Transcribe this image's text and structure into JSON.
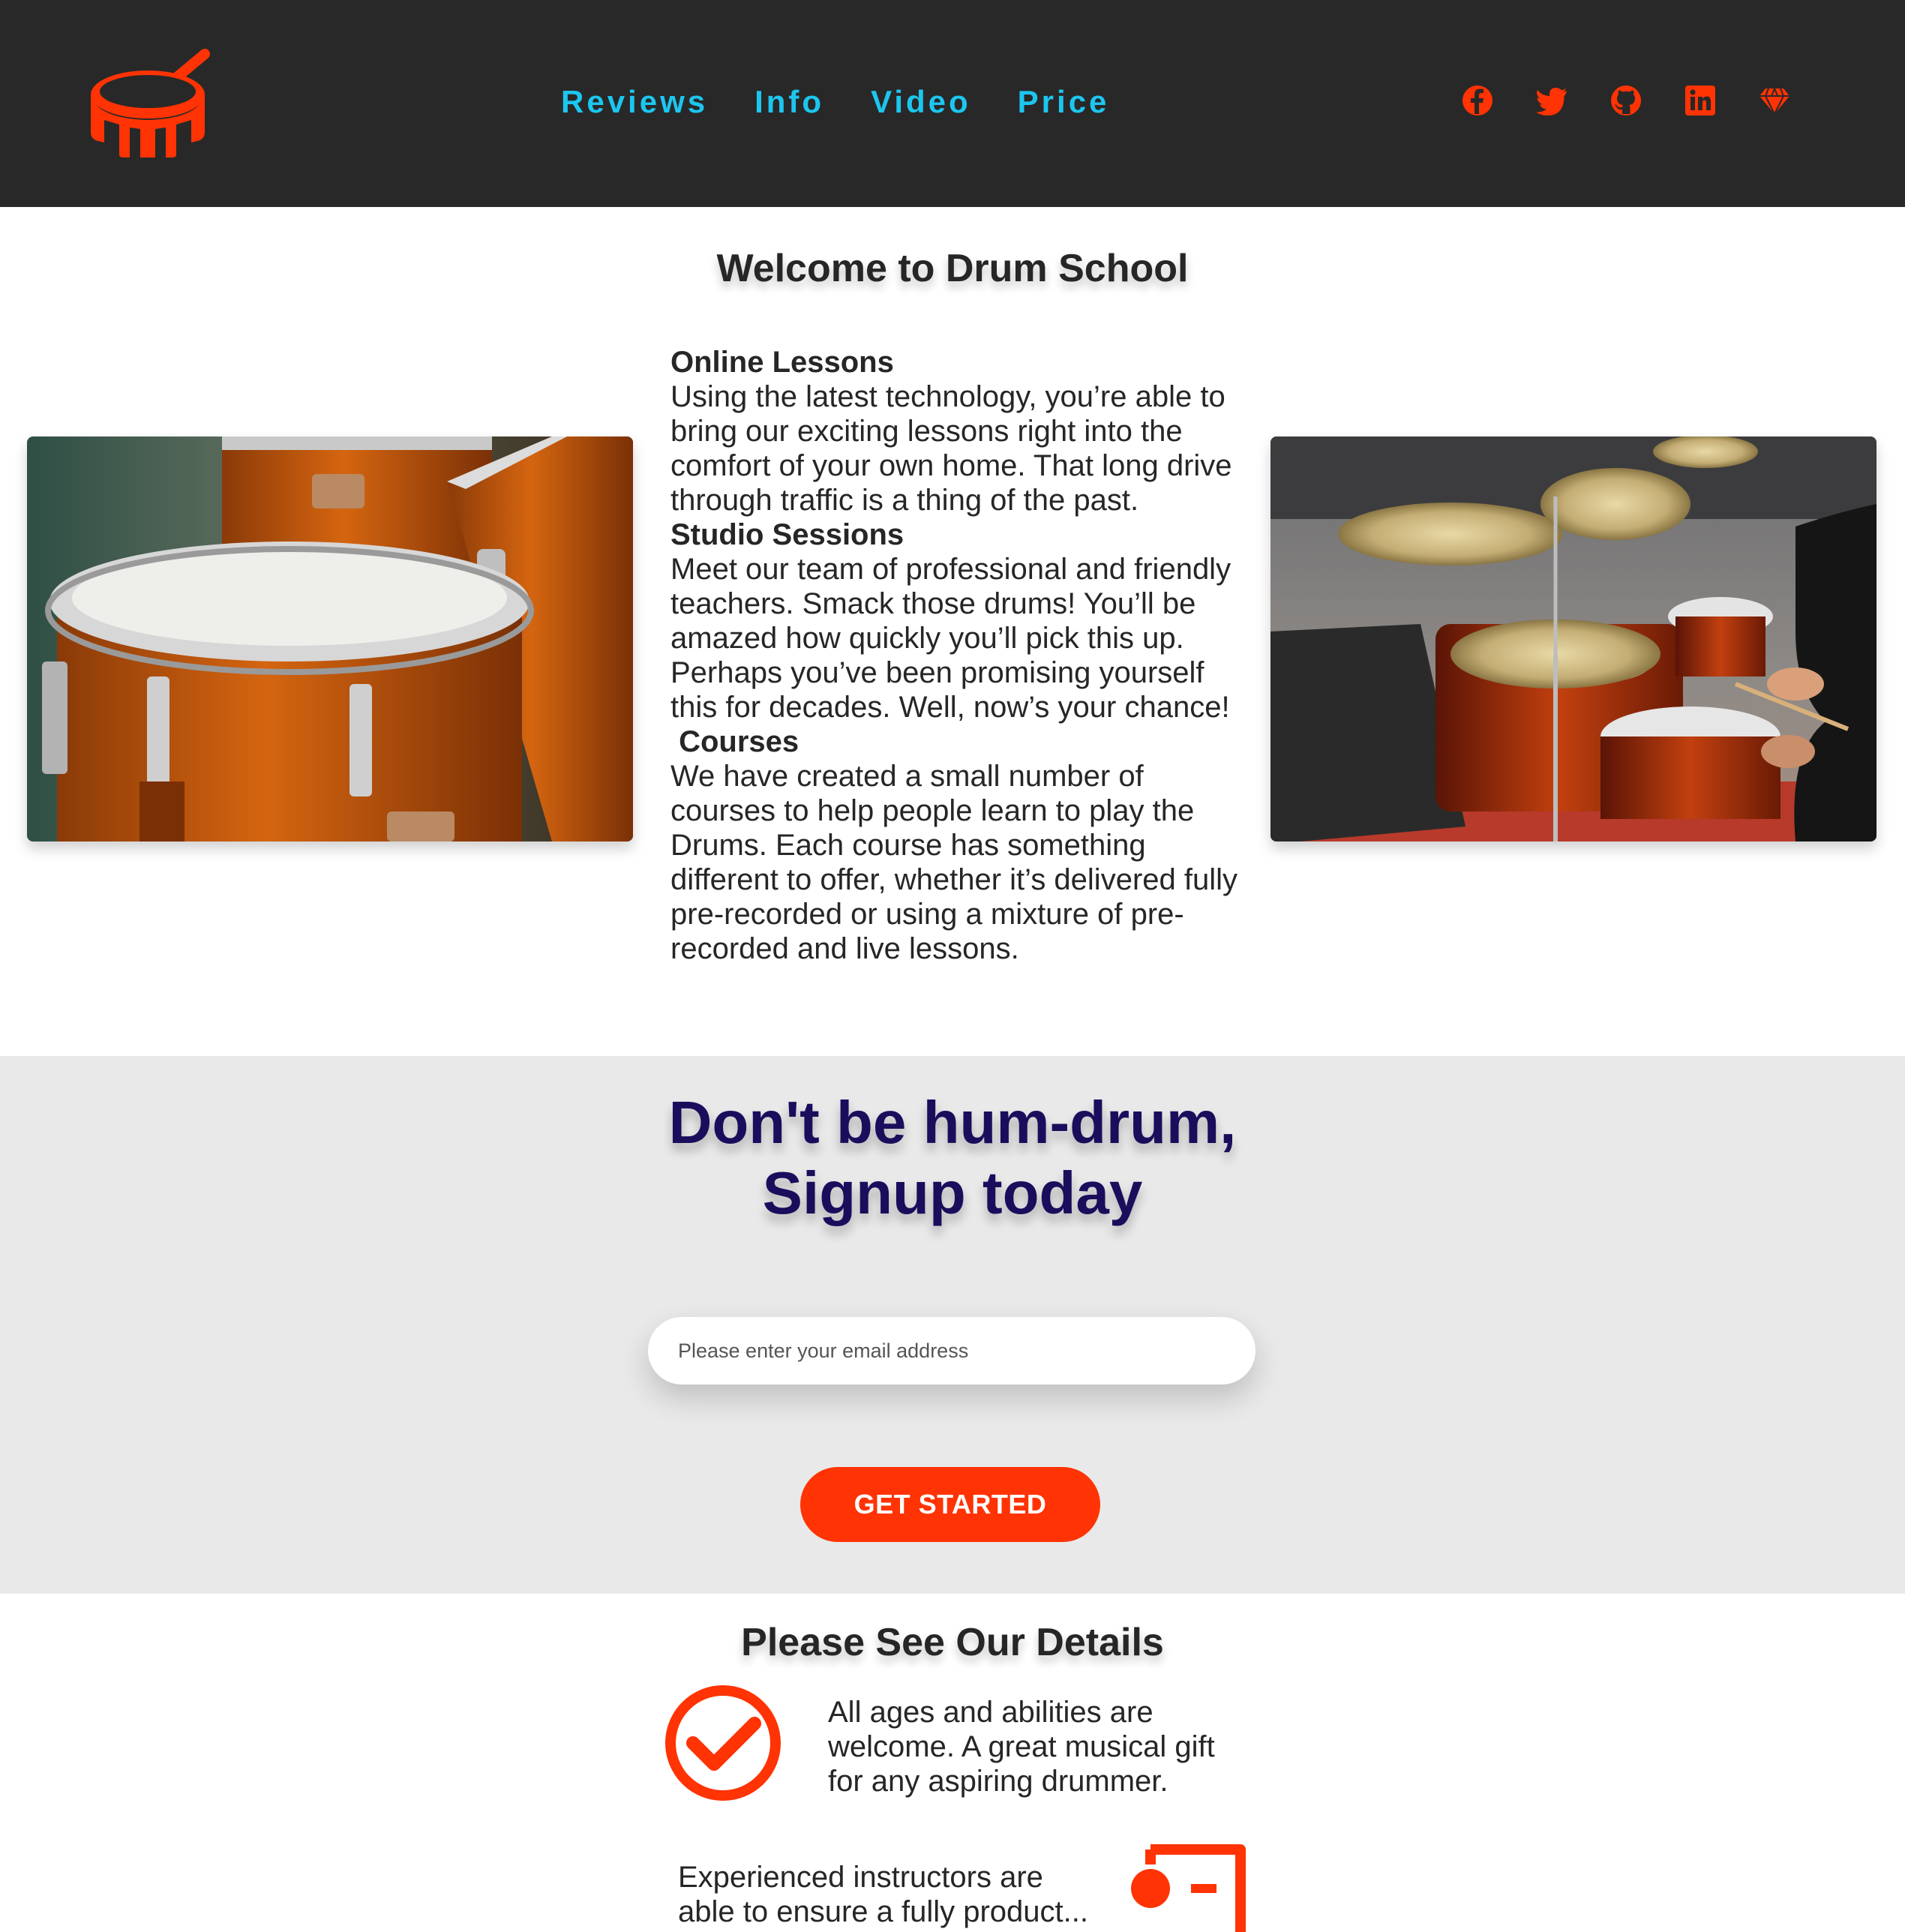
{
  "nav": {
    "items": [
      "Reviews",
      "Info",
      "Video",
      "Price"
    ]
  },
  "socials": [
    "facebook-icon",
    "twitter-icon",
    "github-icon",
    "linkedin-icon",
    "gem-icon"
  ],
  "colors": {
    "header_bg": "#282828",
    "nav_link": "#1cc6ef",
    "accent": "#ff3303",
    "signup_title": "#1b0d5c",
    "signup_bg": "#e9e9e9"
  },
  "welcome": {
    "title": "Welcome to Drum School",
    "sections": [
      {
        "heading": "Online Lessons",
        "body": "Using the latest technology, you’re able to bring our exciting lessons right into the comfort of your own home. That long drive through traffic is a thing of the past."
      },
      {
        "heading": "Studio Sessions",
        "body": "Meet our team of professional and friendly teachers. Smack those drums! You’ll be amazed how quickly you’ll pick this up. Perhaps you’ve been promising yourself this for decades. Well, now’s your chance!"
      },
      {
        "heading": " Courses",
        "body": "We have created a small number of courses to help people learn to play the Drums. Each course has something different to offer, whether it’s delivered fully pre-recorded or using a mixture of pre-recorded and live lessons."
      }
    ]
  },
  "signup": {
    "title_line1": "Don't be hum-drum,",
    "title_line2": "Signup today",
    "email_placeholder": "Please enter your email address",
    "button_label": "GET STARTED"
  },
  "details": {
    "title": "Please See Our Details",
    "items": [
      {
        "icon": "checkmark-circle-icon",
        "text": "All ages and abilities are welcome. A great musical gift for any aspiring drummer."
      },
      {
        "icon": "chalkboard-teacher-icon",
        "text": "Experienced instructors are able to ensure a fully product..."
      }
    ]
  }
}
